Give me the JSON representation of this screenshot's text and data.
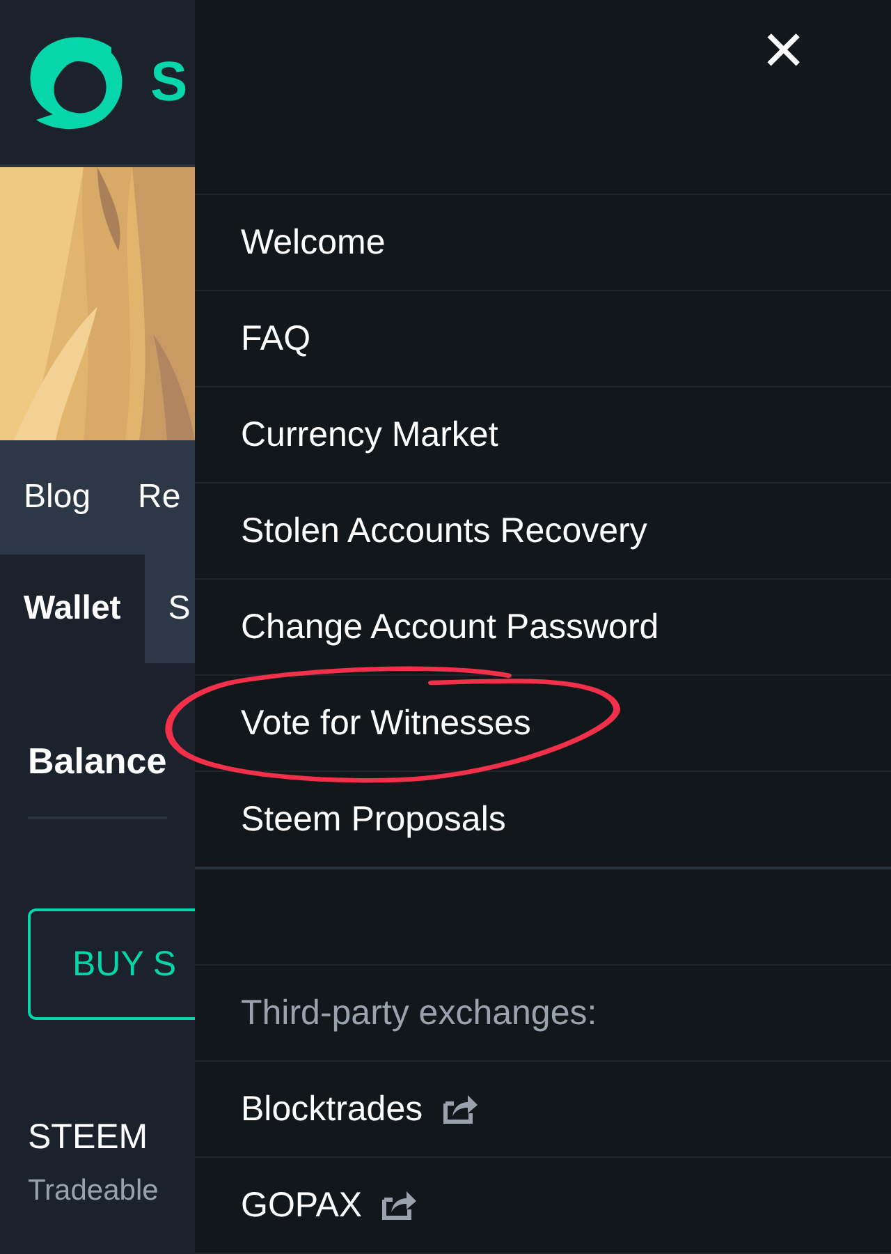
{
  "header": {
    "logo_text": "S"
  },
  "nav": [
    {
      "label": "Blog",
      "selected": false
    },
    {
      "label": "Re",
      "selected": false
    }
  ],
  "tabs": [
    {
      "label": "Wallet",
      "selected": true
    },
    {
      "label": "S",
      "selected": false
    }
  ],
  "balance_title": "Balance",
  "buy_button": "BUY S",
  "token": {
    "name": "STEEM",
    "description": "Tradeable"
  },
  "menu": {
    "close": "×",
    "items": [
      {
        "kind": "link",
        "label": "Welcome"
      },
      {
        "kind": "link",
        "label": "FAQ"
      },
      {
        "kind": "link",
        "label": "Currency Market"
      },
      {
        "kind": "link",
        "label": "Stolen Accounts Recovery"
      },
      {
        "kind": "link",
        "label": "Change Account Password"
      },
      {
        "kind": "link",
        "label": "Vote for Witnesses",
        "circled": true
      },
      {
        "kind": "link",
        "label": "Steem Proposals"
      },
      {
        "kind": "spacer"
      },
      {
        "kind": "heading",
        "label": "Third-party exchanges:"
      },
      {
        "kind": "external",
        "label": "Blocktrades"
      },
      {
        "kind": "external",
        "label": "GOPAX"
      }
    ]
  }
}
